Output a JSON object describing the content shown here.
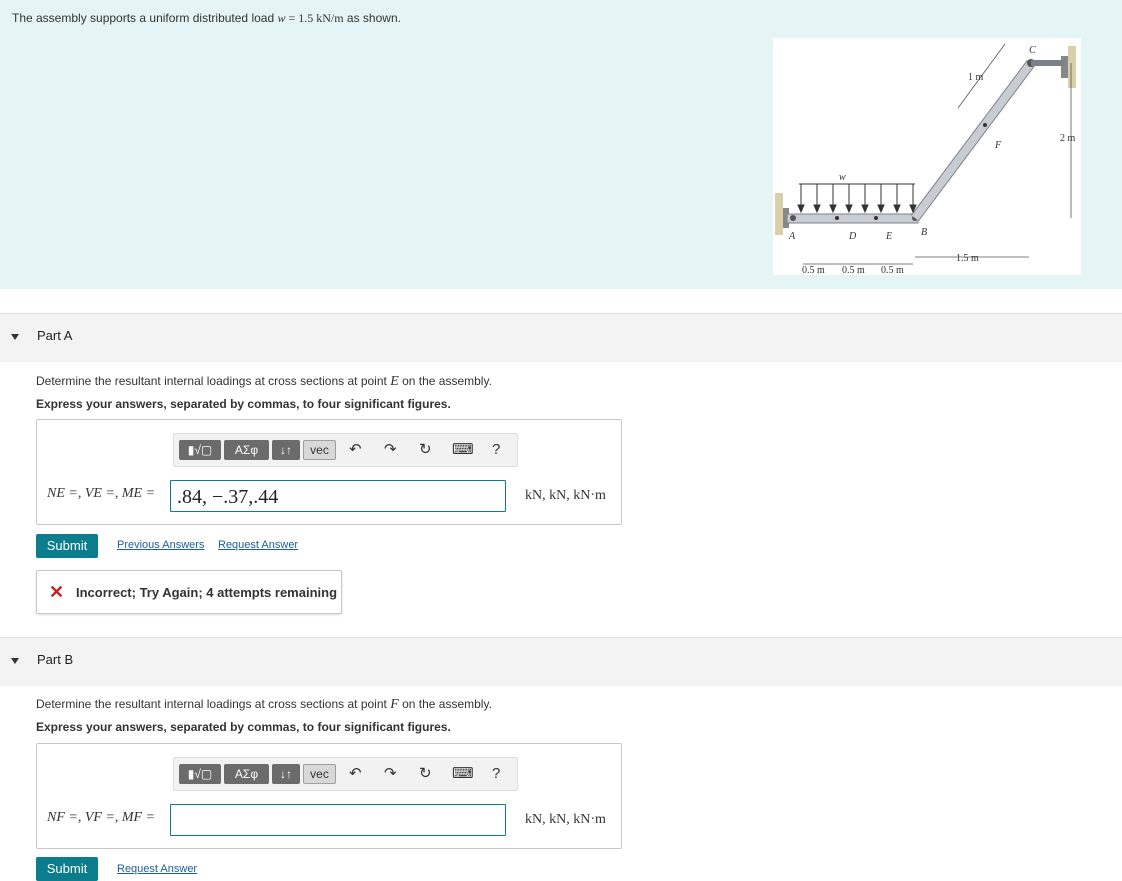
{
  "problem": {
    "text_prefix": "The assembly supports a uniform distributed load ",
    "w_sym": "w",
    "w_eq": " = 1.5 kN/m",
    "text_suffix": " as shown."
  },
  "figure": {
    "labels": {
      "A": "A",
      "B": "B",
      "C": "C",
      "D": "D",
      "E": "E",
      "F": "F",
      "w": "w",
      "dim_1m": "1 m",
      "dim_2m": "2 m",
      "dim_15m": "1.5 m",
      "dim_05a": "0.5 m",
      "dim_05b": "0.5 m",
      "dim_05c": "0.5 m"
    }
  },
  "partA": {
    "label": "Part A",
    "instr_prefix": "Determine the resultant internal loadings at cross sections at point ",
    "point": "E",
    "instr_suffix": " on the assembly.",
    "express": "Express your answers, separated by commas, to four significant figures.",
    "eq_label": "NE =, VE =, ME =",
    "answer_value": ".84, −.37,.44",
    "units": "kN, kN, kN·m",
    "submit": "Submit",
    "prev_answers": "Previous Answers",
    "request_answer": "Request Answer",
    "feedback": "Incorrect; Try Again; 4 attempts remaining"
  },
  "partB": {
    "label": "Part B",
    "instr_prefix": "Determine the resultant internal loadings at cross sections at point ",
    "point": "F",
    "instr_suffix": " on the assembly.",
    "express": "Express your answers, separated by commas, to four significant figures.",
    "eq_label": "NF =, VF =, MF =",
    "answer_value": "",
    "units": "kN, kN, kN·m",
    "submit": "Submit",
    "request_answer": "Request Answer"
  },
  "toolbar": {
    "templates": "▮√▢",
    "greek": "ΑΣφ",
    "arrows": "↓↑",
    "vec": "vec",
    "undo": "↶",
    "redo": "↷",
    "reset": "↻",
    "keyboard": "⌨",
    "help": "?"
  },
  "colors": {
    "accent": "#0b7d8d",
    "problem_bg": "#e5f5f5",
    "error": "#cc1f1f",
    "link": "#1a5e9a"
  }
}
